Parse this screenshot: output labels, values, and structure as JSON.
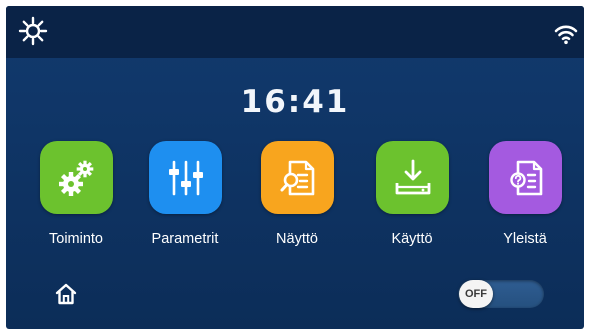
{
  "header": {
    "left_icon": "sun-icon",
    "right_icon": "wifi-icon"
  },
  "clock": {
    "time": "16:41"
  },
  "menu": [
    {
      "label": "Toiminto",
      "icon": "gears-icon",
      "color": "#6cc22e"
    },
    {
      "label": "Parametrit",
      "icon": "sliders-icon",
      "color": "#1e8ff0"
    },
    {
      "label": "Näyttö",
      "icon": "document-search-icon",
      "color": "#f8a51e"
    },
    {
      "label": "Käyttö",
      "icon": "download-icon",
      "color": "#6cc22e"
    },
    {
      "label": "Yleistä",
      "icon": "document-question-icon",
      "color": "#a45ae0"
    }
  ],
  "footer": {
    "home_icon": "home-icon",
    "toggle": {
      "text": "OFF",
      "state": "off"
    }
  },
  "colors": {
    "background": "#0f3566",
    "topbar": "#0a2347"
  }
}
